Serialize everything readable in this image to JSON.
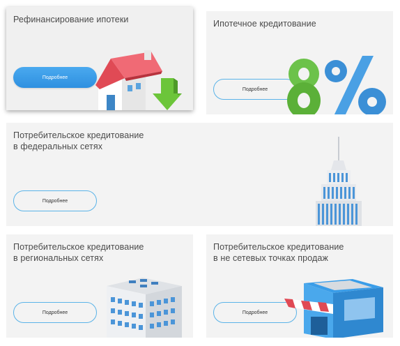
{
  "cards": [
    {
      "title": "Рефинансирование ипотеки",
      "button_label": "Подробнее",
      "illustration": "house-with-down-arrow-icon"
    },
    {
      "title": "Ипотечное кредитование",
      "button_label": "Подробнее",
      "illustration": "eight-percent-icon"
    },
    {
      "title": "Потребительское кредитование\nв федеральных сетях",
      "button_label": "Подробнее",
      "illustration": "skyscraper-icon"
    },
    {
      "title": "Потребительское кредитование\nв региональных сетях",
      "button_label": "Подробнее",
      "illustration": "office-building-icon"
    },
    {
      "title": "Потребительское кредитование\nв не сетевых точках продаж",
      "button_label": "Подробнее",
      "illustration": "shop-kiosk-icon"
    }
  ],
  "big_text": "8%",
  "colors": {
    "accent_blue": "#3a9de8",
    "outline_blue": "#5ab3e8",
    "card_bg": "#f3f3f3",
    "title_text": "#4a4a4a",
    "eight_green": "#6cc24a",
    "percent_blue": "#3b8fd6",
    "roof_red": "#e04a55",
    "arrow_green": "#6cc53a"
  }
}
